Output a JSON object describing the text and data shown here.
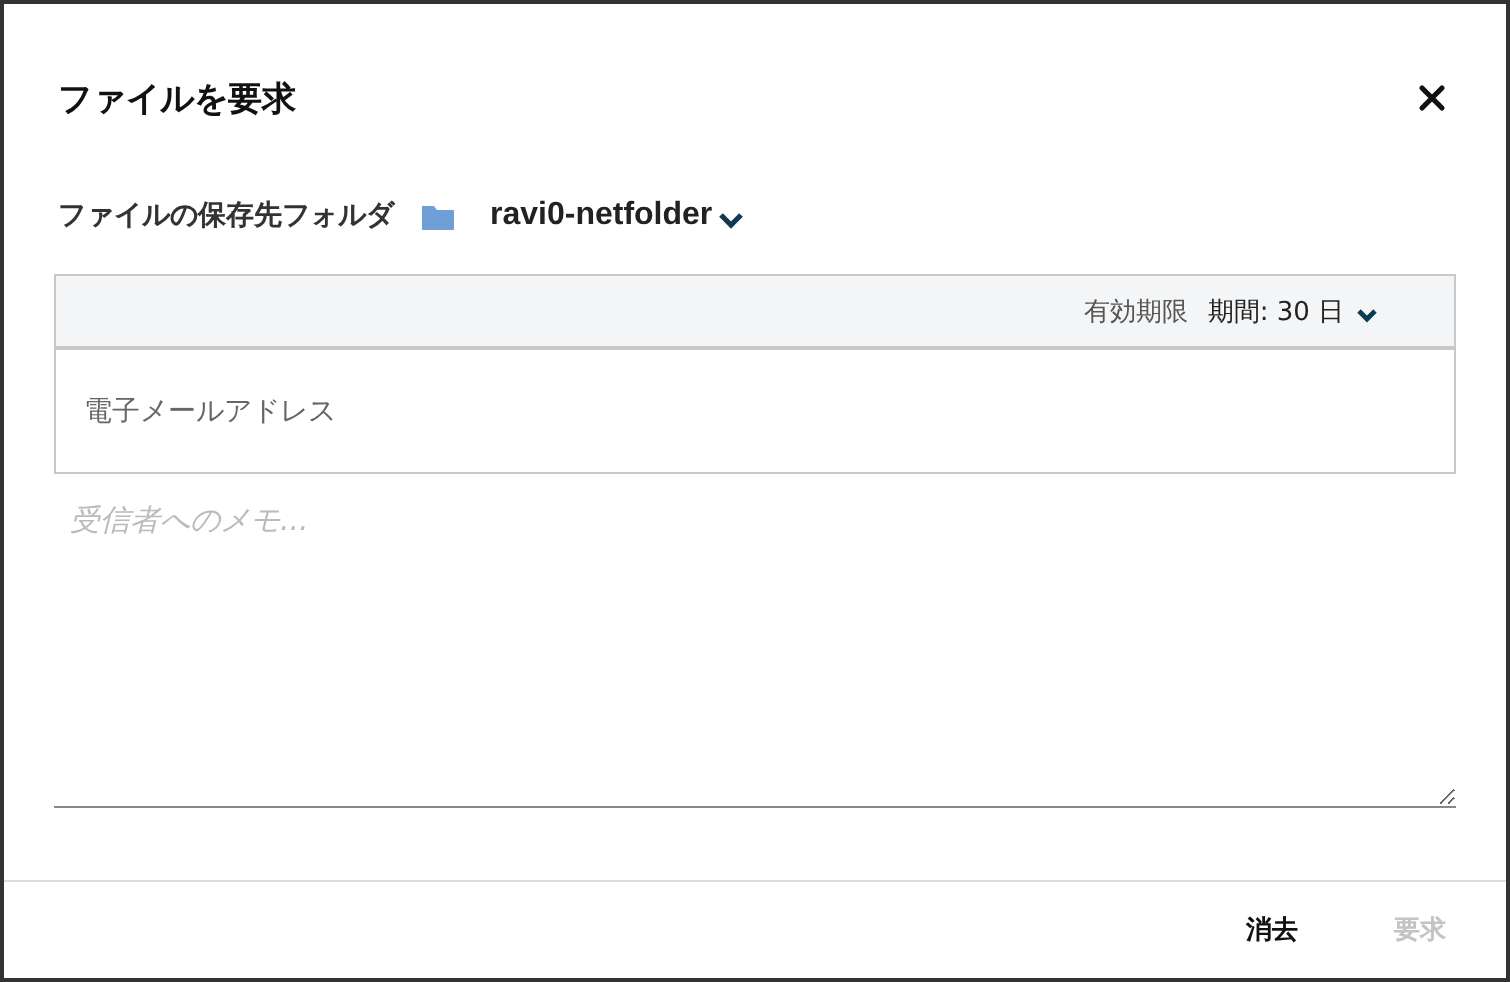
{
  "dialog": {
    "title": "ファイルを要求"
  },
  "folder": {
    "label": "ファイルの保存先フォルダ",
    "name": "ravi0-netfolder"
  },
  "expiration": {
    "label": "有効期限",
    "period": "期間: 30 日"
  },
  "email": {
    "placeholder": "電子メールアドレス"
  },
  "memo": {
    "placeholder": "受信者へのメモ..."
  },
  "buttons": [
    {
      "label": "消去",
      "disabled": false
    },
    {
      "label": "要求",
      "disabled": true
    }
  ]
}
